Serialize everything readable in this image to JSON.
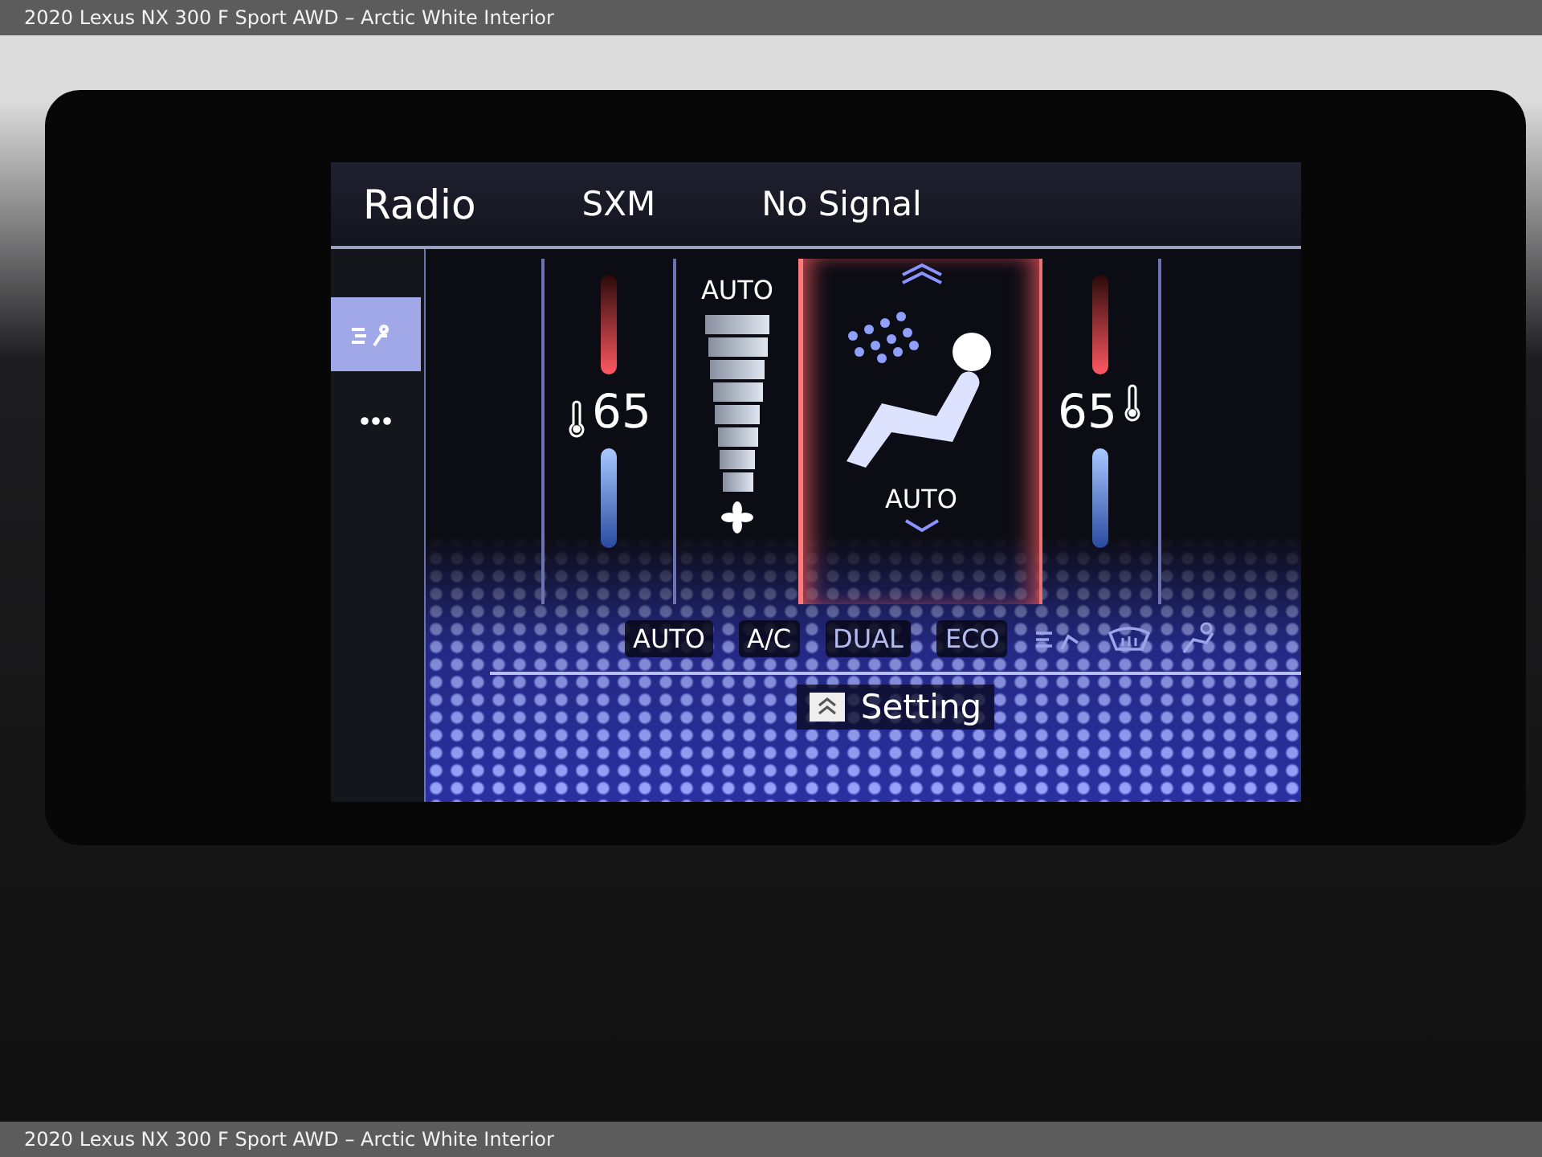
{
  "caption_top": "2020 Lexus NX 300 F Sport AWD – Arctic White Interior",
  "screen": {
    "header": [
      "Radio",
      "SXM",
      "No Signal"
    ],
    "sidebar": [
      {
        "kind": "climate",
        "selected": true
      },
      {
        "kind": "more",
        "selected": false
      }
    ],
    "driver": {
      "temp": "65"
    },
    "fan": {
      "mode": "AUTO"
    },
    "airflow": {
      "mode": "AUTO"
    },
    "passenger": {
      "temp": "65"
    },
    "controls": [
      {
        "label": "AUTO",
        "disabled": false
      },
      {
        "label": "A/C",
        "disabled": false
      },
      {
        "label": "DUAL",
        "disabled": true
      },
      {
        "label": "ECO",
        "disabled": true
      }
    ],
    "setting": "Setting"
  },
  "caption_bottom": "2020 Lexus NX 300 F Sport AWD – Arctic White Interior"
}
